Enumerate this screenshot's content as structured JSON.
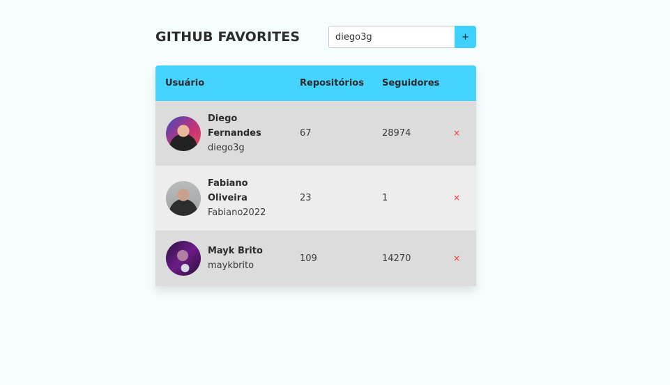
{
  "app": {
    "title": "GITHUB FAVORITES"
  },
  "search": {
    "value": "diego3g",
    "add_label": "+"
  },
  "table": {
    "headers": {
      "user": "Usuário",
      "repos": "Repositórios",
      "followers": "Seguidores"
    },
    "rows": [
      {
        "name": "Diego Fernandes",
        "login": "diego3g",
        "repos": "67",
        "followers": "28974",
        "remove": "×"
      },
      {
        "name": "Fabiano Oliveira",
        "login": "Fabiano2022",
        "repos": "23",
        "followers": "1",
        "remove": "×"
      },
      {
        "name": "Mayk Brito",
        "login": "maykbrito",
        "repos": "109",
        "followers": "14270",
        "remove": "×"
      }
    ]
  },
  "colors": {
    "background": "#f6fdfe",
    "accent": "#45d3ff",
    "row_dark": "#dcdcdc",
    "row_light": "#ededed",
    "remove": "#ff2d2d"
  }
}
